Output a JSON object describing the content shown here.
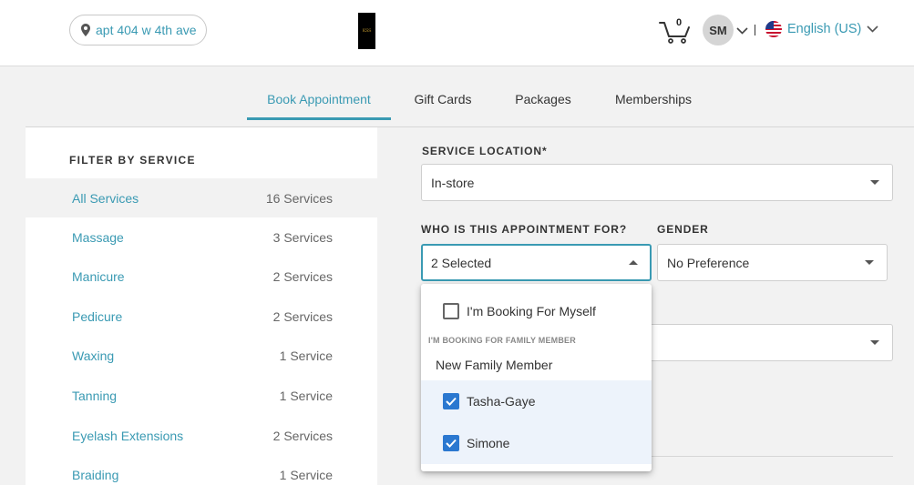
{
  "header": {
    "location": "apt 404 w 4th ave",
    "logo_text": "KSS",
    "cart_count": "0",
    "user_initials": "SM",
    "language": "English (US)"
  },
  "tabs": [
    {
      "label": "Book Appointment",
      "active": true
    },
    {
      "label": "Gift Cards"
    },
    {
      "label": "Packages"
    },
    {
      "label": "Memberships"
    }
  ],
  "sidebar": {
    "title": "FILTER BY SERVICE",
    "services": [
      {
        "name": "All Services",
        "count": "16 Services"
      },
      {
        "name": "Massage",
        "count": "3 Services"
      },
      {
        "name": "Manicure",
        "count": "2 Services"
      },
      {
        "name": "Pedicure",
        "count": "2 Services"
      },
      {
        "name": "Waxing",
        "count": "1 Service"
      },
      {
        "name": "Tanning",
        "count": "1 Service"
      },
      {
        "name": "Eyelash Extensions",
        "count": "2 Services"
      },
      {
        "name": "Braiding",
        "count": "1 Service"
      }
    ]
  },
  "form": {
    "service_location_label": "SERVICE LOCATION*",
    "service_location_value": "In-store",
    "who_label": "WHO IS THIS APPOINTMENT FOR?",
    "who_value": "2 Selected",
    "gender_label": "GENDER",
    "gender_value": "No Preference"
  },
  "dropdown": {
    "myself_label": "I'm Booking For Myself",
    "myself_checked": false,
    "family_group_label": "I'M BOOKING FOR FAMILY MEMBER",
    "new_member_label": "New Family Member",
    "members": [
      {
        "name": "Tasha-Gaye",
        "checked": true
      },
      {
        "name": "Simone",
        "checked": true
      }
    ]
  },
  "colors": {
    "accent": "#3a9ab3",
    "checkbox": "#2b78d0",
    "checked_row": "#edf3fb"
  }
}
